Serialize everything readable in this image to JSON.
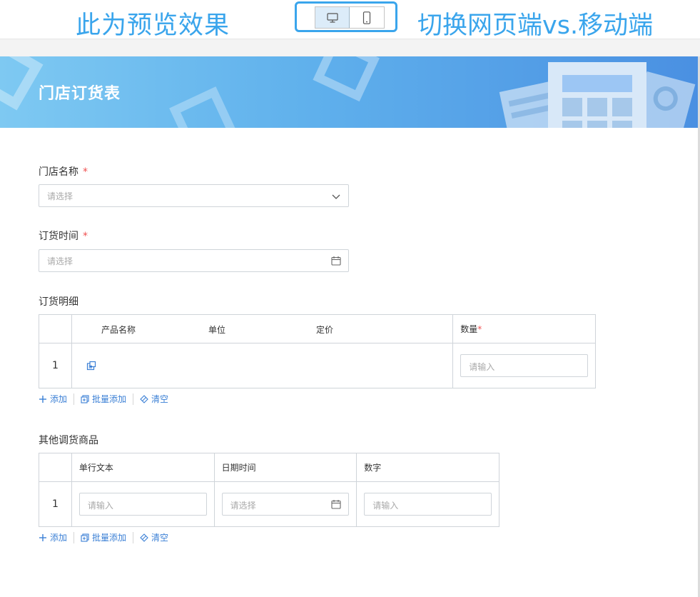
{
  "banner": {
    "preview_text": "此为预览效果",
    "switch_text": "切换网页端vs.移动端",
    "desktop_icon": "desktop-icon",
    "mobile_icon": "mobile-phone-icon"
  },
  "form": {
    "title": "门店订货表",
    "accent_color": "#3a7fd5",
    "fields": {
      "store_name": {
        "label": "门店名称",
        "required_mark": "*",
        "placeholder": "请选择"
      },
      "order_time": {
        "label": "订货时间",
        "required_mark": "*",
        "placeholder": "请选择"
      }
    }
  },
  "order_details": {
    "label": "订货明细",
    "columns": {
      "product_name": "产品名称",
      "unit": "单位",
      "price": "定价",
      "quantity": "数量",
      "quantity_required": "*"
    },
    "rows": [
      {
        "index": "1",
        "quantity_placeholder": "请输入"
      }
    ],
    "actions": {
      "add": "添加",
      "batch_add": "批量添加",
      "clear": "清空"
    }
  },
  "other_goods": {
    "label": "其他调货商品",
    "columns": {
      "text": "单行文本",
      "datetime": "日期时间",
      "number": "数字"
    },
    "rows": [
      {
        "index": "1",
        "text_placeholder": "请输入",
        "datetime_placeholder": "请选择",
        "number_placeholder": "请输入"
      }
    ],
    "actions": {
      "add": "添加",
      "batch_add": "批量添加",
      "clear": "清空"
    }
  }
}
